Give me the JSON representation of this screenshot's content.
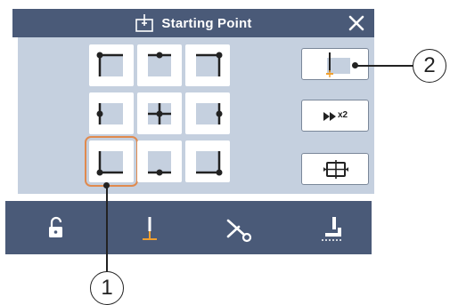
{
  "title": {
    "text": "Starting Point",
    "icon": "starting-point-icon",
    "close_icon": "close-icon"
  },
  "grid": {
    "positions": [
      "top-left",
      "top-center",
      "top-right",
      "middle-left",
      "center",
      "middle-right",
      "bottom-left",
      "bottom-center",
      "bottom-right"
    ],
    "selected": "bottom-left"
  },
  "side_buttons": {
    "needle_icon": "needle-position-icon",
    "fast_forward_label": "x2",
    "fast_forward_icon": "fast-forward-icon",
    "frame_icon": "frame-trace-icon"
  },
  "bottom_bar": {
    "icons": [
      "unlock-icon",
      "needle-icon",
      "thread-cut-icon",
      "presser-foot-icon"
    ]
  },
  "callouts": {
    "one": "1",
    "two": "2"
  },
  "colors": {
    "title_bar": "#4a5a78",
    "panel": "#c5d0df",
    "selection": "#e08a4e",
    "needle_accent": "#f0a030"
  }
}
